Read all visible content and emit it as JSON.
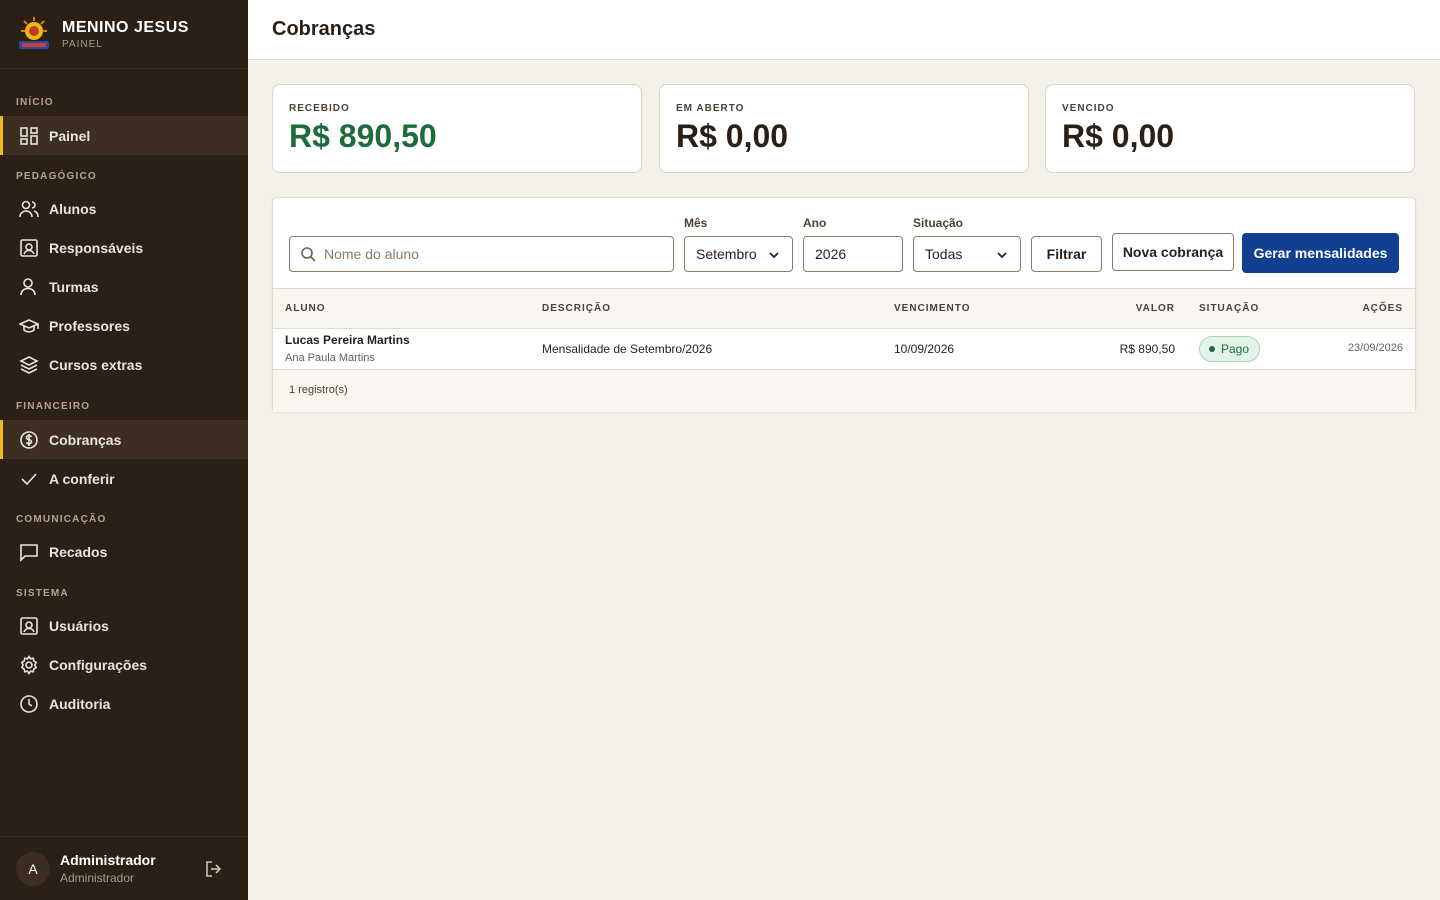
{
  "brand": {
    "title": "MENINO JESUS",
    "subtitle": "PAINEL"
  },
  "sidebar": {
    "sections": [
      "INÍCIO",
      "PEDAGÓGICO",
      "FINANCEIRO",
      "COMUNICAÇÃO",
      "SISTEMA"
    ],
    "items": [
      {
        "label": "Painel",
        "icon": "grid-icon"
      },
      {
        "label": "Alunos",
        "icon": "users-icon"
      },
      {
        "label": "Responsáveis",
        "icon": "id-card-icon"
      },
      {
        "label": "Turmas",
        "icon": "user-icon"
      },
      {
        "label": "Professores",
        "icon": "graduation-cap-icon"
      },
      {
        "label": "Cursos extras",
        "icon": "layers-icon"
      },
      {
        "label": "Cobranças",
        "icon": "dollar-circle-icon"
      },
      {
        "label": "A conferir",
        "icon": "check-icon"
      },
      {
        "label": "Recados",
        "icon": "message-icon"
      },
      {
        "label": "Usuários",
        "icon": "id-card-icon"
      },
      {
        "label": "Configurações",
        "icon": "gear-icon"
      },
      {
        "label": "Auditoria",
        "icon": "clock-icon"
      }
    ]
  },
  "user": {
    "initial": "A",
    "name": "Administrador",
    "role": "Administrador"
  },
  "header": {
    "title": "Cobranças"
  },
  "stats": [
    {
      "label": "RECEBIDO",
      "value": "R$ 890,50"
    },
    {
      "label": "EM ABERTO",
      "value": "R$ 0,00"
    },
    {
      "label": "VENCIDO",
      "value": "R$ 0,00"
    }
  ],
  "filters": {
    "search_placeholder": "Nome do aluno",
    "month_label": "Mês",
    "month_value": "Setembro",
    "year_label": "Ano",
    "year_value": "2026",
    "status_label": "Situação",
    "status_value": "Todas",
    "filter_button": "Filtrar",
    "new_button": "Nova cobrança",
    "generate_button": "Gerar mensalidades"
  },
  "table": {
    "columns": [
      "ALUNO",
      "DESCRIÇÃO",
      "VENCIMENTO",
      "VALOR",
      "SITUAÇÃO",
      "AÇÕES"
    ],
    "rows": [
      {
        "student": "Lucas Pereira Martins",
        "guardian": "Ana Paula Martins",
        "description": "Mensalidade de Setembro/2026",
        "due": "10/09/2026",
        "amount": "R$ 890,50",
        "status": "Pago",
        "actions": "23/09/2026"
      }
    ],
    "footer": "1 registro(s)"
  },
  "colors": {
    "sidebar": "#2c1f15",
    "accent": "#f2b90f",
    "primary": "#123f8f",
    "success": "#1e6b3c"
  }
}
